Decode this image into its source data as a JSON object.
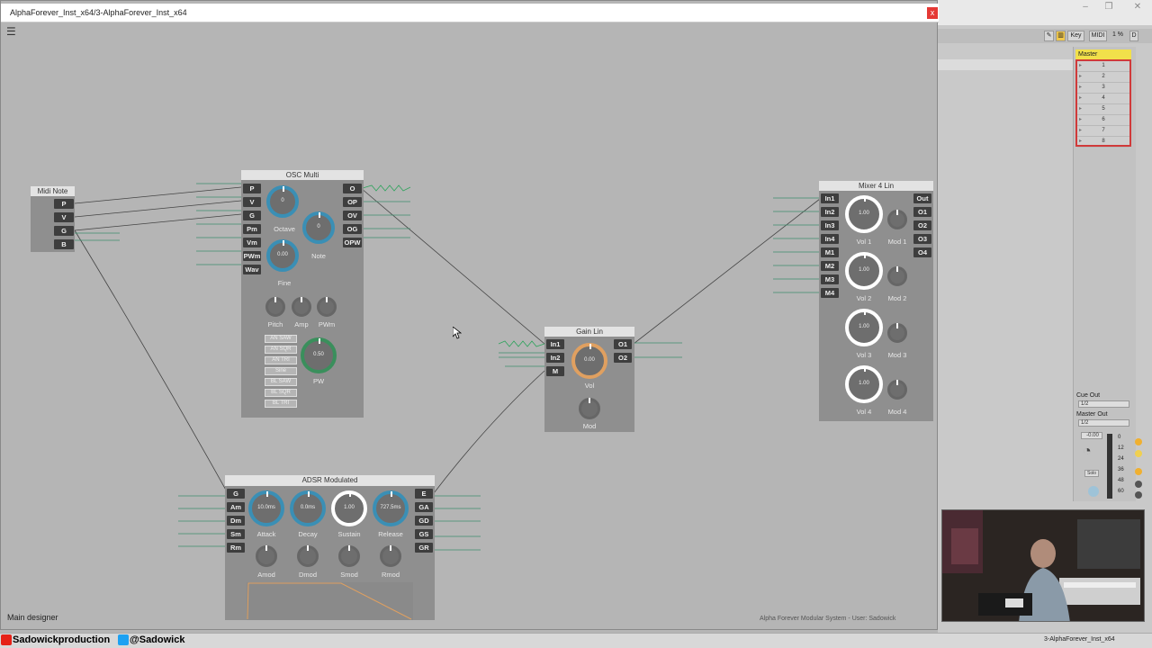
{
  "window": {
    "title": "AlphaForever_Inst_x64/3-AlphaForever_Inst_x64",
    "close": "x",
    "menu_icon": "☰",
    "status_left": "Main designer",
    "status_right": "Alpha Forever Modular System - User: Sadowick"
  },
  "modules": {
    "midi_note": {
      "title": "Midi Note",
      "ports": [
        "P",
        "V",
        "G",
        "B"
      ]
    },
    "osc_multi": {
      "title": "OSC Multi",
      "inputs": [
        "P",
        "V",
        "G",
        "Pm",
        "Vm",
        "PWm",
        "Wav"
      ],
      "outputs": [
        "O",
        "OP",
        "OV",
        "OG",
        "OPW"
      ],
      "knobs": [
        {
          "label": "Octave",
          "value": "0"
        },
        {
          "label": "Note",
          "value": "0"
        },
        {
          "label": "Fine",
          "value": "0.00"
        },
        {
          "label": "Pitch",
          "value": ""
        },
        {
          "label": "Amp",
          "value": ""
        },
        {
          "label": "PWm",
          "value": ""
        },
        {
          "label": "PW",
          "value": "0.50"
        }
      ],
      "waves": [
        "AN SAW",
        "AN SQR",
        "AN TRI",
        "Sine",
        "BL SAW",
        "BL SQR",
        "BL TRI"
      ]
    },
    "gain_lin": {
      "title": "Gain Lin",
      "inputs": [
        "In1",
        "In2",
        "M"
      ],
      "outputs": [
        "O1",
        "O2"
      ],
      "knobs": [
        {
          "label": "Vol",
          "value": "0.00"
        },
        {
          "label": "Mod",
          "value": ""
        }
      ]
    },
    "mixer": {
      "title": "Mixer 4 Lin",
      "inputs": [
        "In1",
        "In2",
        "In3",
        "In4",
        "M1",
        "M2",
        "M3",
        "M4"
      ],
      "outputs": [
        "Out",
        "O1",
        "O2",
        "O3",
        "O4"
      ],
      "channels": [
        {
          "vol_label": "Vol 1",
          "mod_label": "Mod 1",
          "value": "1.00"
        },
        {
          "vol_label": "Vol 2",
          "mod_label": "Mod 2",
          "value": "1.00"
        },
        {
          "vol_label": "Vol 3",
          "mod_label": "Mod 3",
          "value": "1.00"
        },
        {
          "vol_label": "Vol 4",
          "mod_label": "Mod 4",
          "value": "1.00"
        }
      ]
    },
    "adsr": {
      "title": "ADSR Modulated",
      "inputs": [
        "G",
        "Am",
        "Dm",
        "Sm",
        "Rm"
      ],
      "outputs": [
        "E",
        "GA",
        "GD",
        "GS",
        "GR"
      ],
      "knobs": [
        {
          "label": "Attack",
          "value": "10.0ms"
        },
        {
          "label": "Decay",
          "value": "0.0ms"
        },
        {
          "label": "Sustain",
          "value": "1.00"
        },
        {
          "label": "Release",
          "value": "727.5ms"
        }
      ],
      "mods": [
        "Amod",
        "Dmod",
        "Smod",
        "Rmod"
      ]
    }
  },
  "host": {
    "master_title": "Master",
    "tracks": [
      "1",
      "2",
      "3",
      "4",
      "5",
      "6",
      "7",
      "8"
    ],
    "toolbar": [
      "Key",
      "MIDI",
      "1 %",
      "D"
    ],
    "cue_out_label": "Cue Out",
    "cue_out_value": "1/2",
    "master_out_label": "Master Out",
    "master_out_value": "1/2",
    "volume": "-0.00",
    "meter_ticks": [
      "0",
      "12",
      "24",
      "36",
      "48",
      "60"
    ],
    "solo": "Solo",
    "taskbar_item": "3-AlphaForever_Inst_x64"
  },
  "overlay": {
    "youtube": "Sadowickproduction",
    "twitter": "@Sadowick"
  },
  "colors": {
    "accent": "#3a8fb5",
    "ring_orange": "#e0a060",
    "module_bg": "#8f8f8f",
    "port_bg": "#3e3e3e",
    "wire": "#3c8f6c"
  }
}
